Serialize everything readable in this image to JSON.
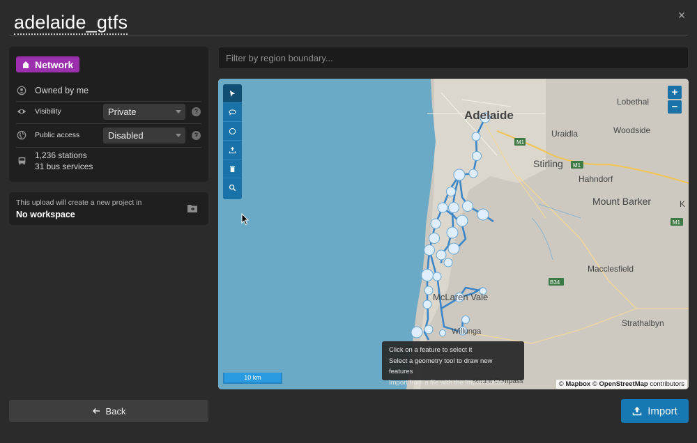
{
  "title": "adelaide_gtfs",
  "badge": {
    "label": "Network"
  },
  "owner": {
    "label": "Owned by me"
  },
  "visibility": {
    "label": "Visibility",
    "value": "Private"
  },
  "public_access": {
    "label": "Public access",
    "value": "Disabled"
  },
  "stats": {
    "stations": "1,236 stations",
    "services": "31 bus services"
  },
  "upload_notice": {
    "line1": "This upload will create a new project in",
    "workspace": "No workspace"
  },
  "filter": {
    "placeholder": "Filter by region boundary..."
  },
  "map": {
    "labels": [
      "Adelaide",
      "Lobethal",
      "Uraidla",
      "Woodside",
      "Stirling",
      "Hahndorf",
      "Mount Barker",
      "K",
      "Macclesfield",
      "McLaren Vale",
      "Willunga",
      "Strathalbyn",
      "Mount Compass"
    ],
    "road_shields": [
      "M1",
      "M1",
      "M1",
      "B34"
    ],
    "scale": "10 km",
    "attribution": {
      "copyright": "©",
      "mapbox": "Mapbox",
      "copyright2": "©",
      "osm": "OpenStreetMap",
      "contributors": "contributors"
    },
    "tooltip": [
      "Click on a feature to select it",
      "Select a geometry tool to draw new features",
      "Import from a file with the Import button"
    ],
    "zoom_in": "+",
    "zoom_out": "−"
  },
  "buttons": {
    "back": "Back",
    "import": "Import",
    "close": "×"
  },
  "colors": {
    "badge": "#9b2fae",
    "accent": "#1778b3",
    "water": "#6aaac6",
    "route": "#3a86c8"
  }
}
